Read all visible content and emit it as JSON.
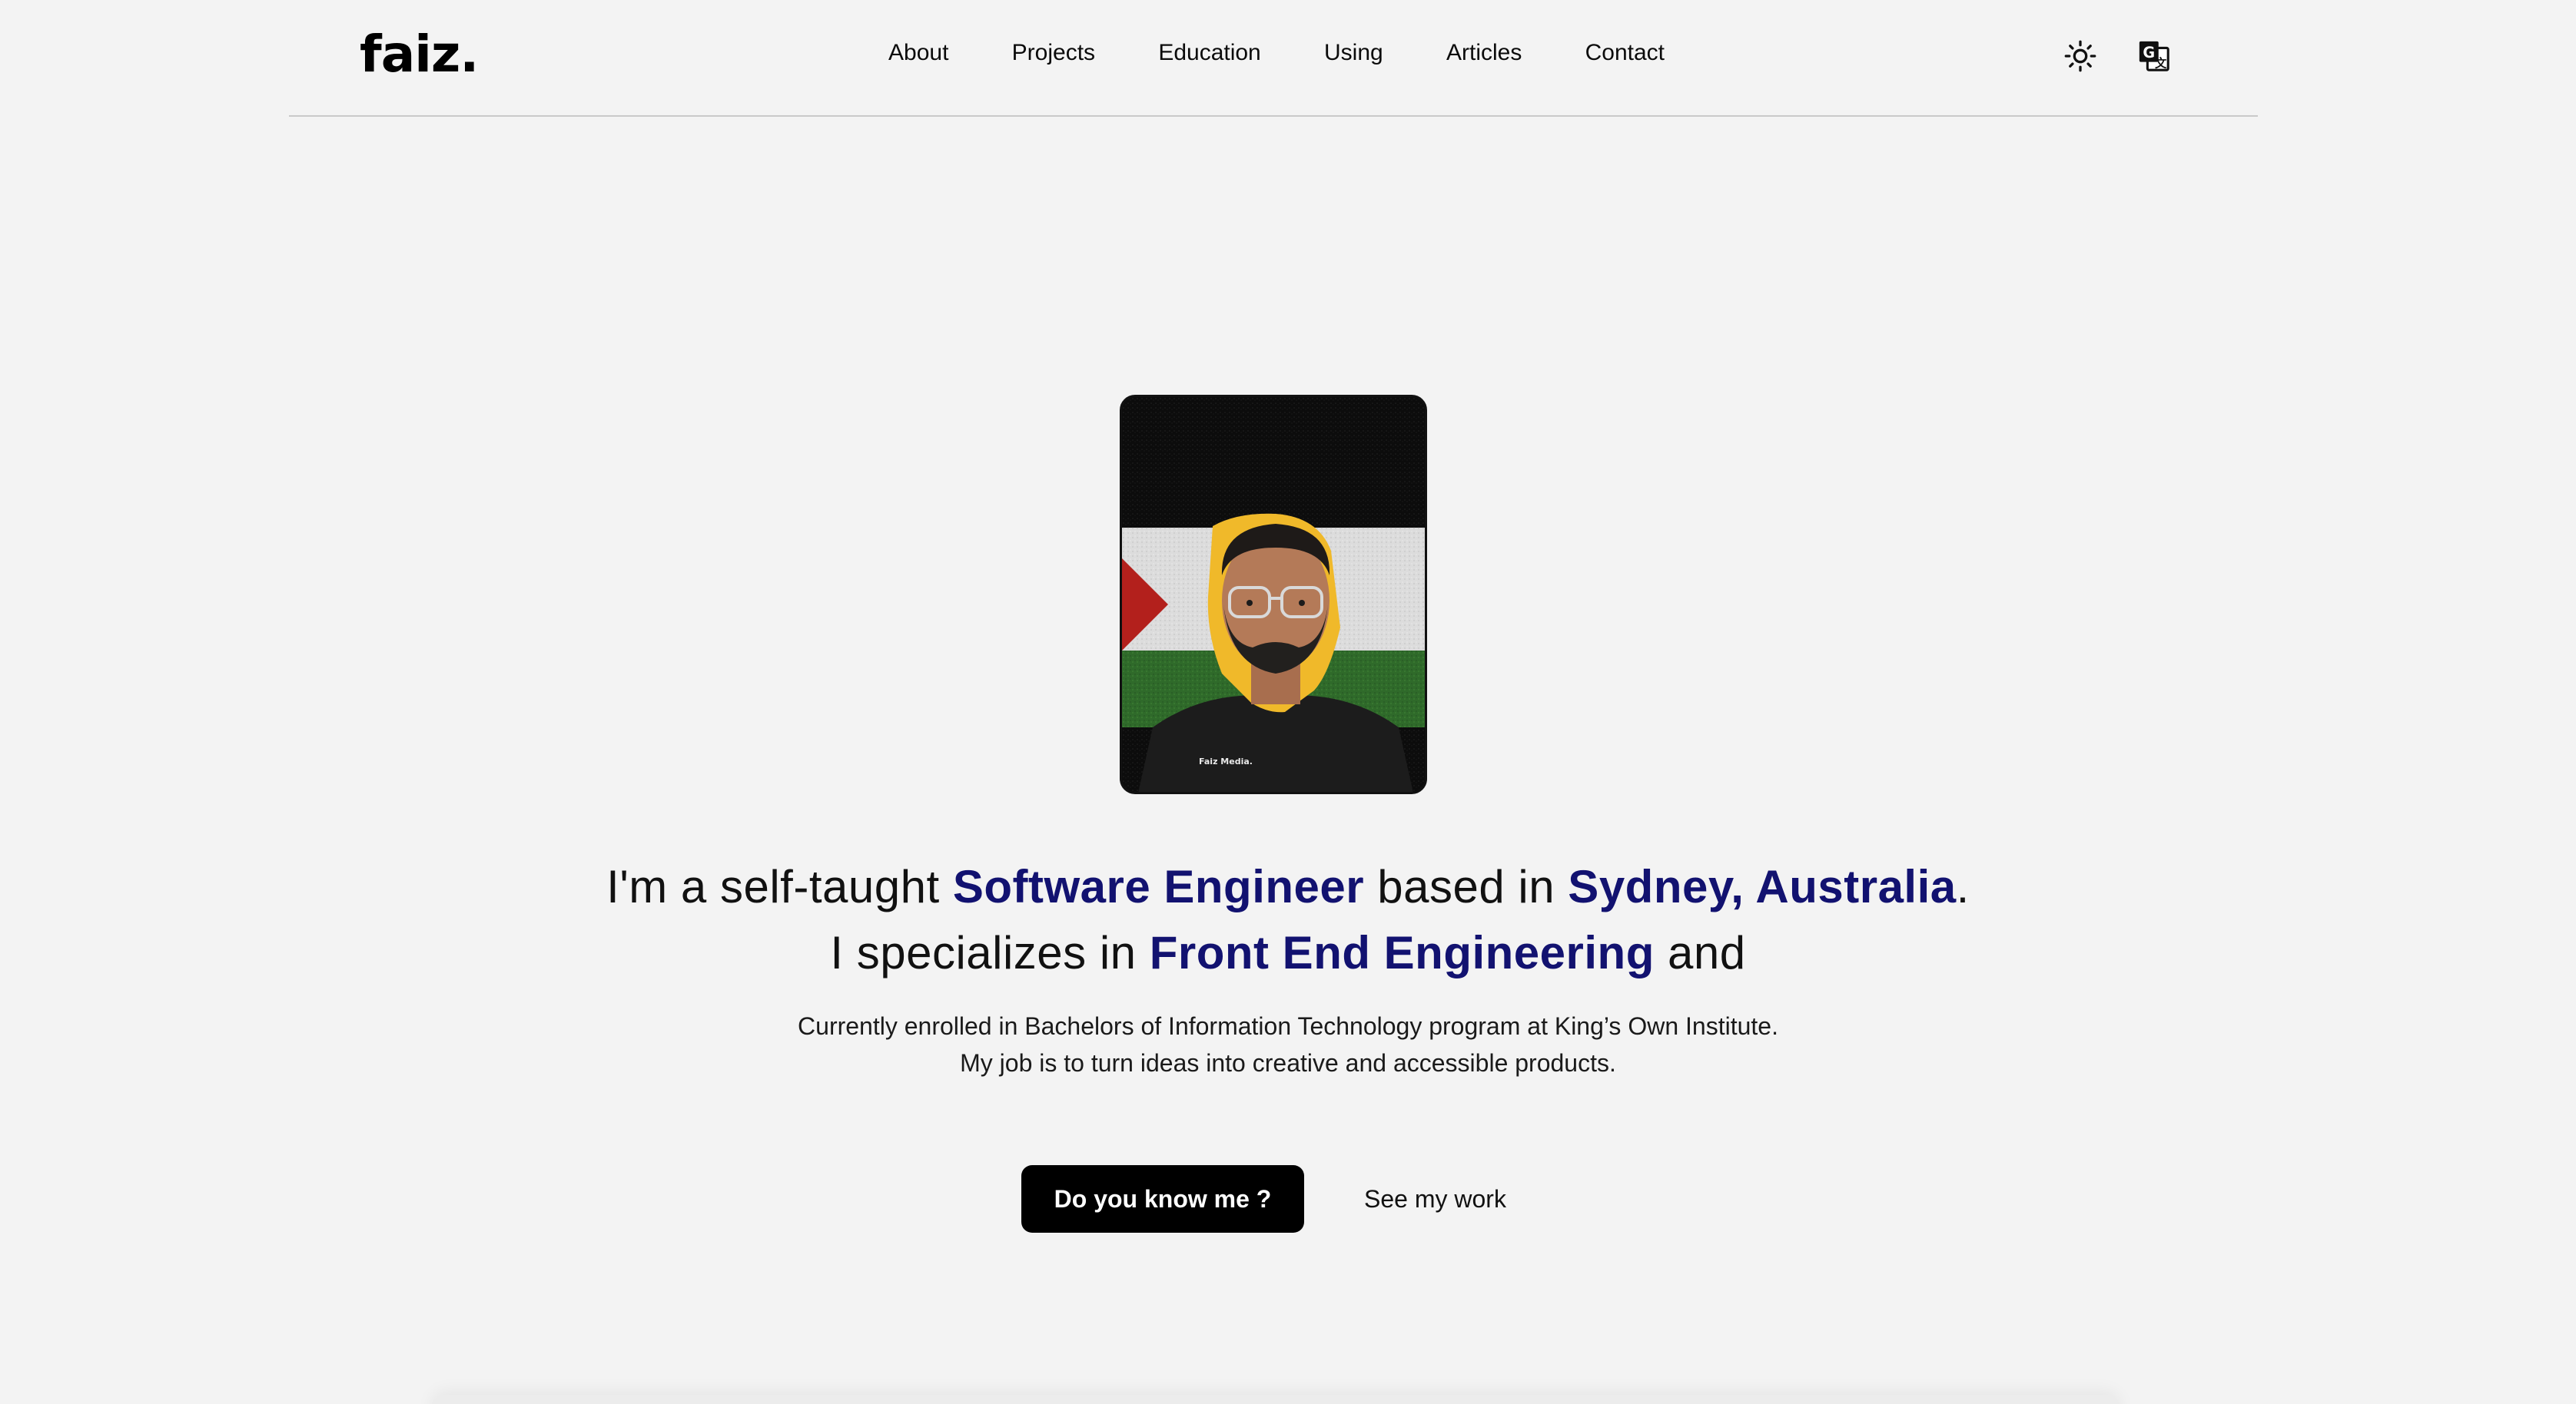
{
  "brand": {
    "logo_text": "faiz."
  },
  "nav": {
    "items": [
      {
        "label": "About"
      },
      {
        "label": "Projects"
      },
      {
        "label": "Education"
      },
      {
        "label": "Using"
      },
      {
        "label": "Articles"
      },
      {
        "label": "Contact"
      }
    ]
  },
  "header_icons": {
    "theme_toggle": "sun-icon",
    "language_toggle": "translate-icon"
  },
  "portrait": {
    "shirt_text": "Faiz Media."
  },
  "hero": {
    "line1": {
      "pre": "I'm a self-taught ",
      "role": "Software Engineer",
      "mid": " based in ",
      "location": "Sydney, Australia",
      "post": "."
    },
    "line2": {
      "pre": "I specializes in ",
      "specialty": "Front End Engineering",
      "post": " and"
    },
    "subtitle_line1": "Currently enrolled in Bachelors of Information Technology program at King’s Own Institute.",
    "subtitle_line2": "My job is to turn ideas into creative and accessible products."
  },
  "cta": {
    "primary_label": "Do you know me ?",
    "secondary_label": "See my work"
  },
  "colors": {
    "background": "#f3f3f3",
    "highlight_text": "#121270",
    "primary_button": "#000000"
  }
}
